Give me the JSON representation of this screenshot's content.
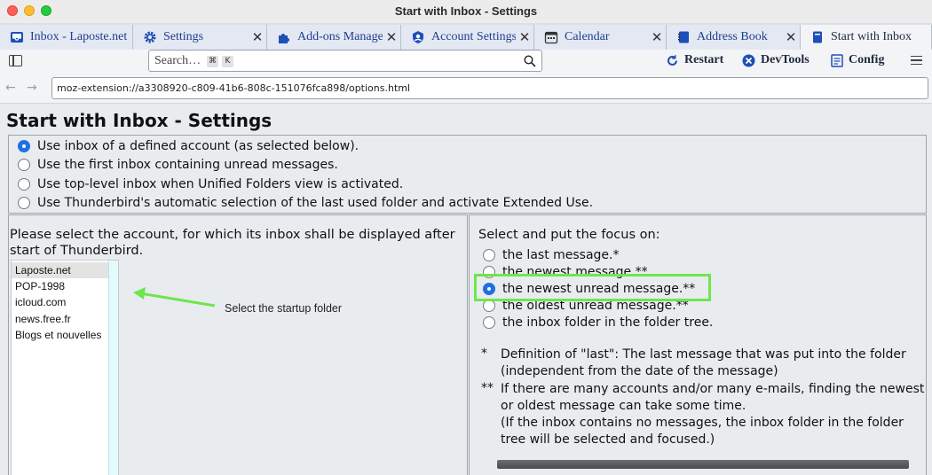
{
  "window": {
    "title": "Start with Inbox - Settings"
  },
  "tabs": [
    {
      "label": "Inbox - Laposte.net",
      "icon": "inbox-icon"
    },
    {
      "label": "Settings",
      "icon": "gear-icon"
    },
    {
      "label": "Add-ons Manager",
      "icon": "puzzle-icon"
    },
    {
      "label": "Account Settings",
      "icon": "account-icon"
    },
    {
      "label": "Calendar",
      "icon": "calendar-icon"
    },
    {
      "label": "Address Book",
      "icon": "address-book-icon"
    },
    {
      "label": "Start with Inbox",
      "icon": "book-icon"
    }
  ],
  "toolbar": {
    "search_placeholder": "Search…",
    "search_key1": "⌘",
    "search_key2": "K",
    "restart": "Restart",
    "devtools": "DevTools",
    "config": "Config"
  },
  "url": "moz-extension://a3308920-c809-41b6-808c-151076fca898/options.html",
  "page": {
    "title": "Start with Inbox - Settings",
    "mode_options": [
      "Use inbox of a defined account (as selected below).",
      "Use the first inbox containing unread messages.",
      "Use top-level inbox when Unified Folders view is activated.",
      "Use Thunderbird's automatic selection of the last used folder and activate Extended Use."
    ],
    "account_prompt_line1": "Please select the account, for which its inbox shall be displayed after",
    "account_prompt_line2": "start of Thunderbird.",
    "accounts": [
      "Laposte.net",
      "POP-1998",
      "icloud.com",
      "news.free.fr",
      "Blogs et nouvelles"
    ],
    "annotation": "Select the startup folder",
    "focus_prompt": "Select and put the focus on:",
    "focus_options": [
      "the last message.*",
      "the newest message.**",
      "the newest unread message.**",
      "the oldest unread message.**",
      "the inbox folder in the folder tree."
    ],
    "note1_mark": "*",
    "note1_line1": "Definition of \"last\": The last message that was put into the folder",
    "note1_line2": "(independent from the date of the message)",
    "note2_mark": "**",
    "note2_line1": "If there are many accounts and/or many e-mails, finding the newest",
    "note2_line2": "or oldest message can take some time.",
    "note2_line3": "(If the inbox contains no messages, the inbox folder in the folder",
    "note2_line4": "tree will be selected and focused.)"
  },
  "colors": {
    "accent": "#1f6fe5",
    "highlight": "#6ee64c",
    "tab_text": "#1f3f8c"
  }
}
